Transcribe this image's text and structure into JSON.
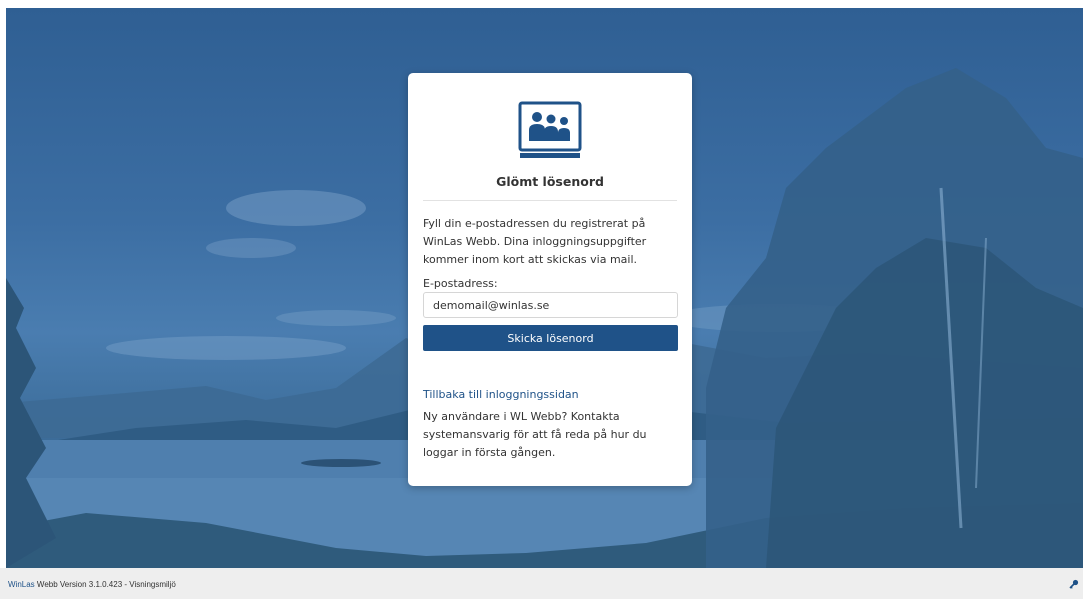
{
  "card": {
    "title": "Glömt lösenord",
    "description": "Fyll din e-postadressen du registrerat på WinLas Webb. Dina inloggningsuppgifter kommer inom kort att skickas via mail.",
    "email_label": "E-postadress:",
    "email_value": "demomail@winlas.se",
    "send_button_label": "Skicka lösenord",
    "back_link_label": "Tillbaka till inloggningssidan",
    "new_user_text": "Ny användare i WL Webb? Kontakta systemansvarig för att få reda på hur du loggar in första gången."
  },
  "footer": {
    "brand": "WinLas",
    "version_text": " Webb Version 3.1.0.423 - Visningsmiljö"
  },
  "icons": {
    "logo": "people-screen-icon",
    "footer": "key-icon"
  },
  "colors": {
    "brand": "#1f5288",
    "background_overlay": "#3c6ea3"
  }
}
